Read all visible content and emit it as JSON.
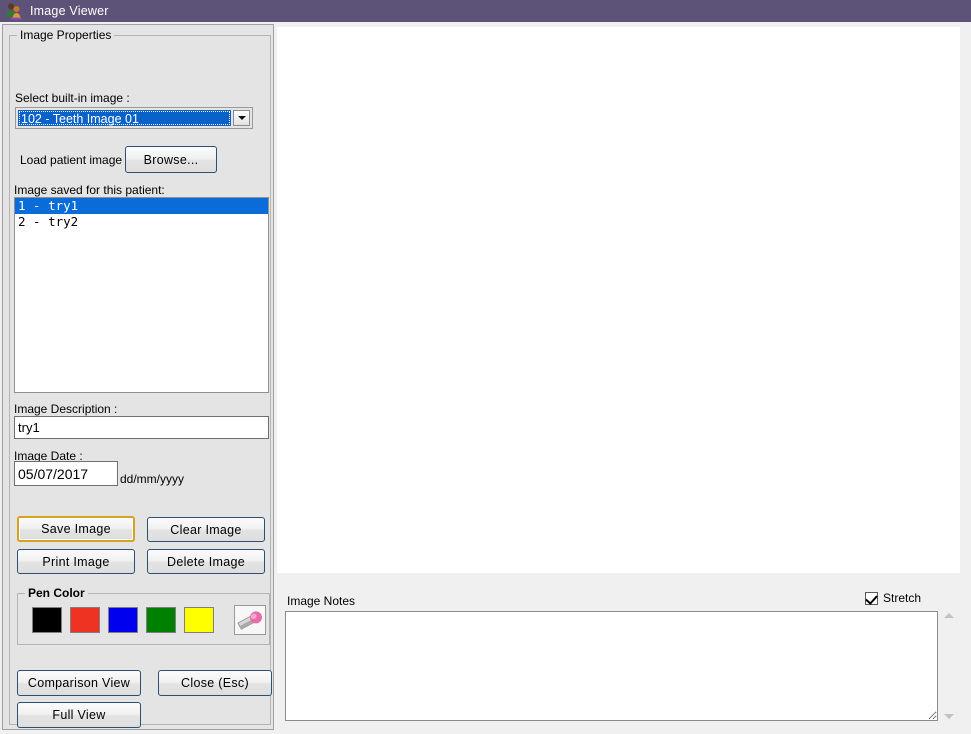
{
  "window": {
    "title": "Image Viewer",
    "icon": "patients-icon",
    "titlebar_color": "#5d5378"
  },
  "sidebar": {
    "group_title": "Image Properties",
    "builtin_label": "Select built-in image :",
    "builtin_combo": {
      "name": "builtin-image-combo",
      "value": "102 - Teeth Image 01",
      "arrow_icon": "chevron-down-icon"
    },
    "load_patient_label": "Load patient image :",
    "browse_button": "Browse...",
    "saved_images_label": "Image saved for this patient:",
    "saved_images": [
      {
        "text": "1 - try1",
        "selected": true
      },
      {
        "text": "2 - try2",
        "selected": false
      }
    ],
    "description_label": "Image Description :",
    "description_value": "try1",
    "description_placeholder": "",
    "date_label": "Image Date :",
    "date_value": "05/07/2017",
    "date_placeholder": "",
    "date_format_hint": "dd/mm/yyyy",
    "buttons": {
      "save": "Save Image",
      "clear": "Clear Image",
      "print": "Print Image",
      "delete": "Delete Image",
      "comparison": "Comparison View",
      "close": "Close (Esc)",
      "full_view": "Full View"
    },
    "pen_color": {
      "group_title": "Pen Color",
      "swatches": [
        {
          "name": "pen-color-black",
          "hex": "#000000"
        },
        {
          "name": "pen-color-red",
          "hex": "#ee3322"
        },
        {
          "name": "pen-color-blue",
          "hex": "#0000ee"
        },
        {
          "name": "pen-color-green",
          "hex": "#008000"
        },
        {
          "name": "pen-color-yellow",
          "hex": "#ffff00"
        }
      ],
      "eraser_icon": "eraser-icon"
    }
  },
  "main": {
    "image_canvas_color": "#ffffff",
    "notes_label": "Image Notes",
    "notes_value": "",
    "notes_placeholder": "",
    "stretch_label": "Stretch",
    "stretch_checked": true,
    "scroll_up_icon": "scroll-up-arrow-icon",
    "scroll_down_icon": "scroll-down-arrow-icon"
  }
}
